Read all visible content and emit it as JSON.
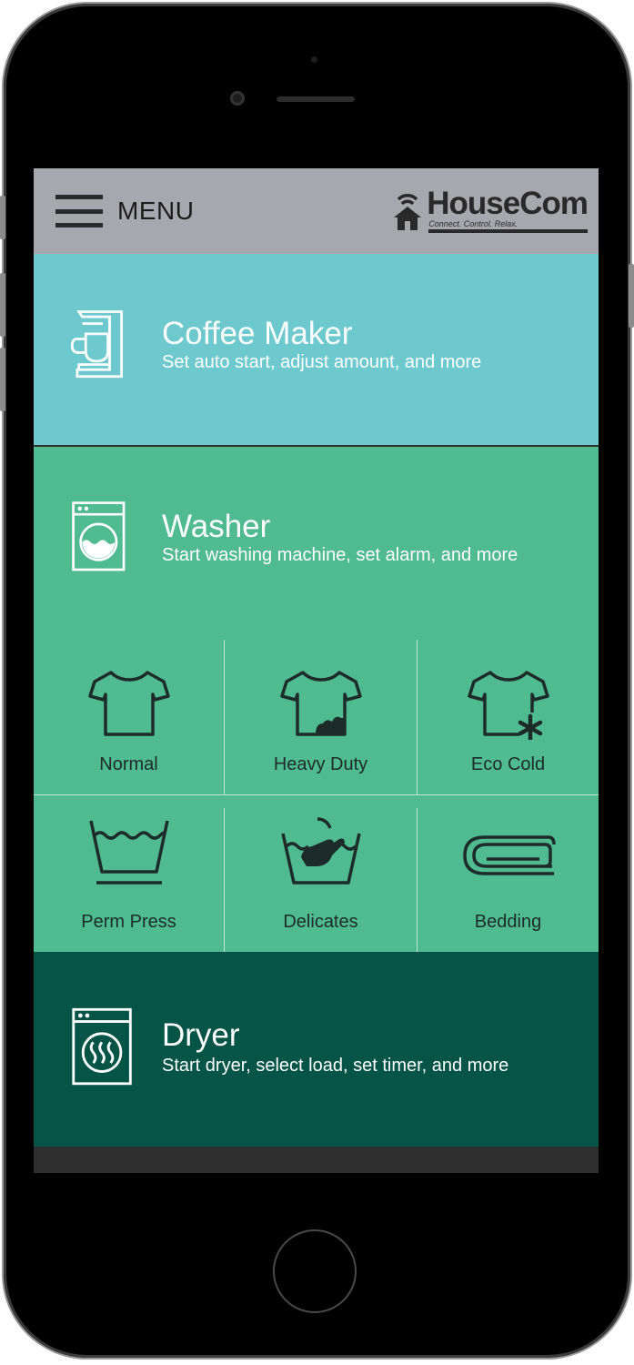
{
  "header": {
    "menu_label": "MENU",
    "logo_name": "HouseCom",
    "logo_tagline": "Connect. Control. Relax."
  },
  "devices": {
    "coffee": {
      "title": "Coffee Maker",
      "subtitle": "Set auto start, adjust amount, and more",
      "icon": "coffee-maker-icon"
    },
    "washer": {
      "title": "Washer",
      "subtitle": "Start washing machine, set alarm, and more",
      "icon": "washing-machine-icon"
    },
    "dryer": {
      "title": "Dryer",
      "subtitle": "Start dryer, select load, set timer, and more",
      "icon": "dryer-icon"
    }
  },
  "washer_modes": [
    {
      "label": "Normal",
      "icon": "tshirt-icon"
    },
    {
      "label": "Heavy Duty",
      "icon": "stained-tshirt-icon"
    },
    {
      "label": "Eco Cold",
      "icon": "tshirt-snowflake-icon"
    },
    {
      "label": "Perm Press",
      "icon": "wash-basin-icon"
    },
    {
      "label": "Delicates",
      "icon": "hand-wash-icon"
    },
    {
      "label": "Bedding",
      "icon": "folded-blanket-icon"
    }
  ],
  "colors": {
    "topbar": "#a7a7ae",
    "coffee": "#6ec9cf",
    "washer": "#50ba90",
    "dryer": "#045447"
  }
}
